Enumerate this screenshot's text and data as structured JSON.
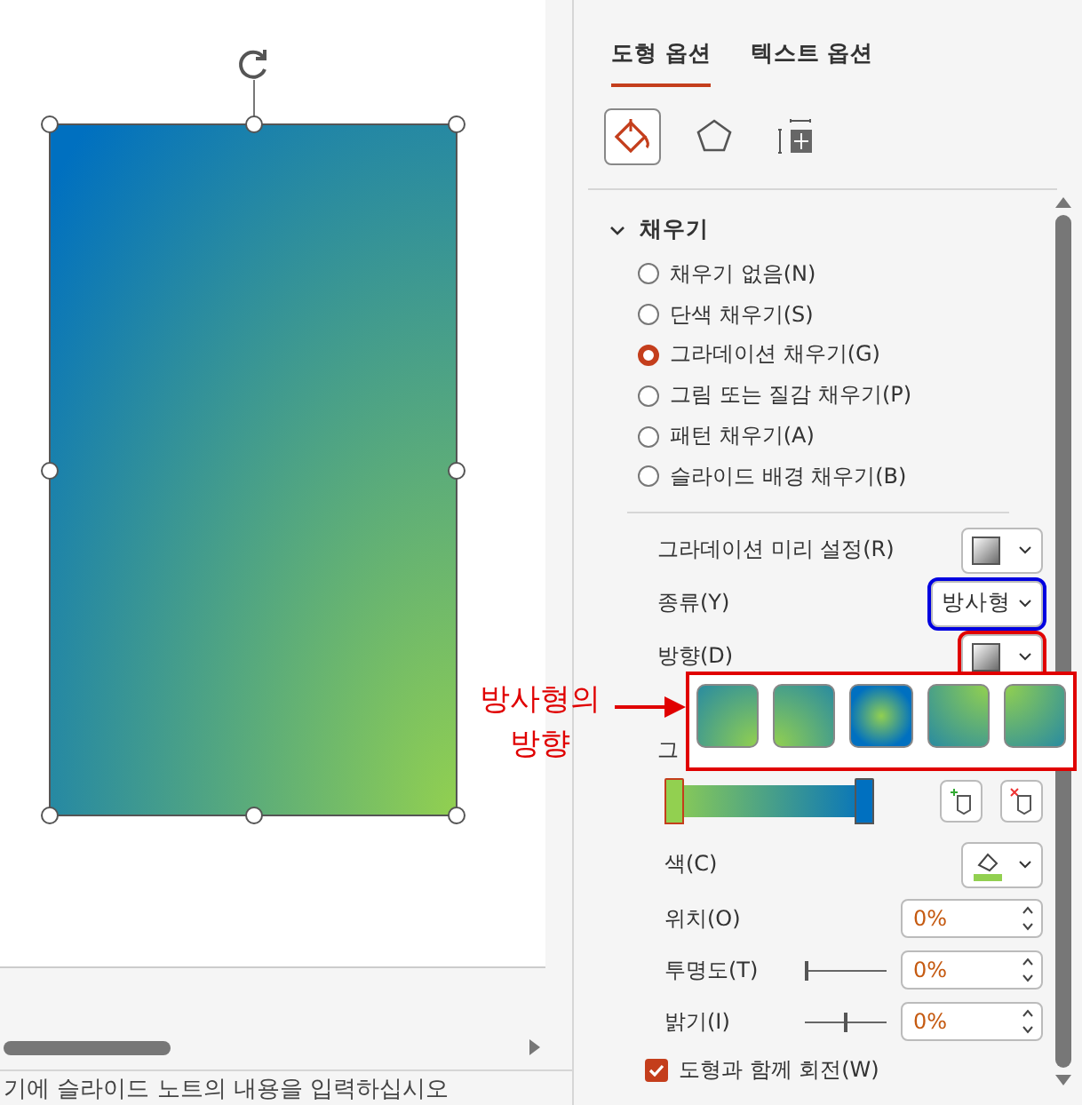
{
  "tabs": [
    {
      "label": "도형 옵션",
      "selected": true
    },
    {
      "label": "텍스트 옵션",
      "selected": false
    }
  ],
  "category_icons": [
    {
      "kind": "fill",
      "selected": true
    },
    {
      "kind": "shape",
      "selected": false
    },
    {
      "kind": "size",
      "selected": false
    }
  ],
  "section": {
    "title": "채우기",
    "expanded": true
  },
  "fill_options": [
    {
      "label": "채우기 없음(N)",
      "selected": false
    },
    {
      "label": "단색 채우기(S)",
      "selected": false
    },
    {
      "label": "그라데이션 채우기(G)",
      "selected": true
    },
    {
      "label": "그림 또는 질감 채우기(P)",
      "selected": false
    },
    {
      "label": "패턴 채우기(A)",
      "selected": false
    },
    {
      "label": "슬라이드 배경 채우기(B)",
      "selected": false
    }
  ],
  "preset": {
    "label": "그라데이션 미리 설정(R)"
  },
  "type": {
    "label": "종류(Y)",
    "value": "방사형"
  },
  "direction": {
    "label": "방향(D)",
    "options": [
      {
        "kind": "bottom-right"
      },
      {
        "kind": "bottom-left"
      },
      {
        "kind": "center"
      },
      {
        "kind": "top-right"
      },
      {
        "kind": "top-left"
      }
    ]
  },
  "stops_label": "그",
  "gradient_stops": [
    {
      "color": "#92d050",
      "level": 0,
      "selected": true
    },
    {
      "color": "#0070c0",
      "level": 1,
      "selected": false
    }
  ],
  "color": {
    "label": "색(C)",
    "color": "#92d050"
  },
  "position": {
    "label": "위치(O)",
    "value": "0%"
  },
  "transparency": {
    "label": "투명도(T)",
    "value": "0%",
    "level": 0
  },
  "brightness": {
    "label": "밝기(I)",
    "value": "0%",
    "level": 0.5
  },
  "rotate_with_shape": {
    "label": "도형과 함께 회전(W)",
    "checked": true
  },
  "notes": {
    "placeholder": "기에 슬라이드 노트의 내용을 입력하십시오"
  },
  "annotation": {
    "lines": [
      "방사형의",
      "방향"
    ]
  }
}
